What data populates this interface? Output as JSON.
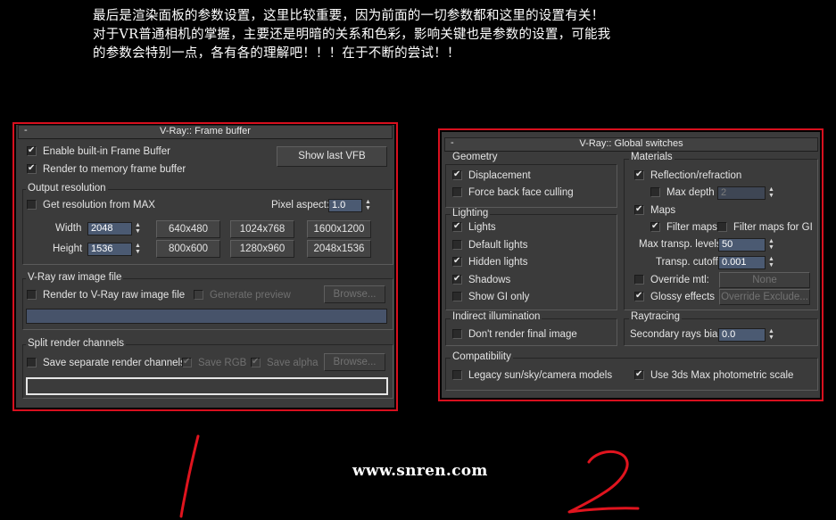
{
  "intro": {
    "line1": "最后是渲染面板的参数设置，这里比较重要，因为前面的一切参数都和这里的设置有关！",
    "line2": "对于VR普通相机的掌握，主要还是明暗的关系和色彩，影响关键也是参数的设置，可能我",
    "line3": "的参数会特别一点，各有各的理解吧！！！在于不断的尝试！！"
  },
  "frame_buffer": {
    "collapse": "-",
    "title": "V-Ray:: Frame buffer",
    "enable_builtin": {
      "label": "Enable built-in Frame Buffer",
      "checked": true
    },
    "render_to_memory": {
      "label": "Render to memory frame buffer",
      "checked": true
    },
    "show_last_vfb": "Show last VFB",
    "output_resolution": {
      "group_label": "Output resolution",
      "get_from_max": {
        "label": "Get resolution from MAX",
        "checked": false
      },
      "pixel_aspect_label": "Pixel aspect:",
      "pixel_aspect_value": "1.0",
      "width_label": "Width",
      "width_value": "2048",
      "height_label": "Height",
      "height_value": "1536",
      "presets_row1": [
        "640x480",
        "1024x768",
        "1600x1200"
      ],
      "presets_row2": [
        "800x600",
        "1280x960",
        "2048x1536"
      ]
    },
    "raw_image": {
      "group_label": "V-Ray raw image file",
      "render_to_raw": {
        "label": "Render to V-Ray raw image file",
        "checked": false
      },
      "generate_preview": {
        "label": "Generate preview",
        "checked": false
      },
      "browse": "Browse..."
    },
    "split_channels": {
      "group_label": "Split render channels",
      "save_separate": {
        "label": "Save separate render channels",
        "checked": false
      },
      "save_rgb": {
        "label": "Save RGB",
        "checked": true
      },
      "save_alpha": {
        "label": "Save alpha",
        "checked": true
      },
      "browse": "Browse..."
    }
  },
  "global_switches": {
    "collapse": "-",
    "title": "V-Ray:: Global switches",
    "geometry": {
      "group_label": "Geometry",
      "displacement": {
        "label": "Displacement",
        "checked": true
      },
      "force_back_face": {
        "label": "Force back face culling",
        "checked": false
      }
    },
    "lighting": {
      "group_label": "Lighting",
      "lights": {
        "label": "Lights",
        "checked": true
      },
      "default_lights": {
        "label": "Default lights",
        "checked": false
      },
      "hidden_lights": {
        "label": "Hidden lights",
        "checked": true
      },
      "shadows": {
        "label": "Shadows",
        "checked": true
      },
      "show_gi_only": {
        "label": "Show GI only",
        "checked": false
      }
    },
    "indirect": {
      "group_label": "Indirect illumination",
      "dont_render_final": {
        "label": "Don't render final image",
        "checked": false
      }
    },
    "materials": {
      "group_label": "Materials",
      "reflection": {
        "label": "Reflection/refraction",
        "checked": true
      },
      "max_depth": {
        "label": "Max depth",
        "checked": false,
        "value": "2"
      },
      "maps": {
        "label": "Maps",
        "checked": true
      },
      "filter_maps": {
        "label": "Filter maps",
        "checked": true
      },
      "filter_maps_gi": {
        "label": "Filter maps for GI",
        "checked": false
      },
      "max_transp_label": "Max transp. levels",
      "max_transp_value": "50",
      "transp_cutoff_label": "Transp. cutoff",
      "transp_cutoff_value": "0.001",
      "override_mtl": {
        "label": "Override mtl:",
        "checked": false
      },
      "override_btn": "None",
      "glossy": {
        "label": "Glossy effects",
        "checked": true
      },
      "override_exclude": "Override Exclude..."
    },
    "raytracing": {
      "group_label": "Raytracing",
      "secondary_label": "Secondary rays bias",
      "secondary_value": "0.0"
    },
    "compatibility": {
      "group_label": "Compatibility",
      "legacy": {
        "label": "Legacy sun/sky/camera models",
        "checked": false
      },
      "photometric": {
        "label": "Use 3ds Max photometric scale",
        "checked": true
      }
    }
  },
  "footer": {
    "url": "www.snren.com"
  },
  "annotations": {
    "mark1": "1",
    "mark2": "2"
  },
  "colors": {
    "highlight_border": "#d8101e",
    "panel_bg": "#3b3b3b",
    "spinner_field": "#4b5a72",
    "page_bg": "#000000"
  }
}
